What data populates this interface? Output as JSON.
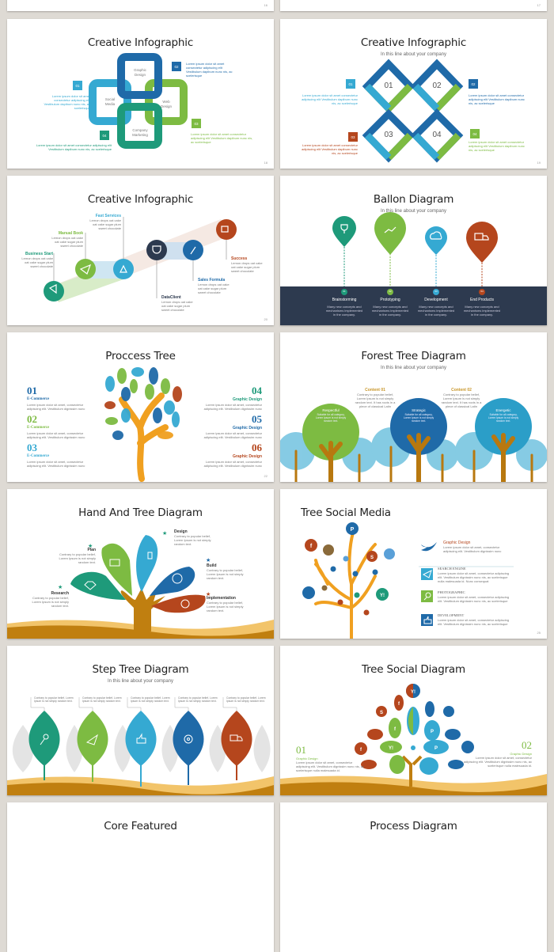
{
  "colors": {
    "background": "#dedad4",
    "teal": "#1e9a7a",
    "green": "#7dbb42",
    "light_blue": "#35a9d2",
    "blue": "#1f6aa8",
    "orange": "#b5461d",
    "navy": "#2d3a4f",
    "brown": "#b8780f"
  },
  "top_row": {
    "left_page": "16",
    "right_page": "17"
  },
  "s1": {
    "title": "Creative Infographic",
    "page": "18",
    "boxes": [
      "Graphic\nDesign",
      "Social\nMedia",
      "Web\nDesign",
      "Company\nMarketing"
    ],
    "badges": [
      "01",
      "02",
      "03",
      "04"
    ],
    "texts": [
      "Lorem ipsum dolor sit amet consectetur adipiscing elit Vestibulum dapibum nunc nis, ac scelerisque",
      "Lorem ipsum dolor sit amet consectetur adipiscing elit Vestibulum dapibum nunc nis, ac scelerisque",
      "Lorem ipsum dolor sit amet consectetur adipiscing elit Vestibulum dapibum nunc nis, ac scelerisque",
      "Lorem ipsum dolor sit amet consectetur adipiscing elit Vestibulum dapibum nunc nis, ac scelerisque"
    ]
  },
  "s2": {
    "title": "Creative Infographic",
    "subtitle": "In this line about your company",
    "page": "19",
    "diamonds": [
      "01",
      "02",
      "03",
      "04"
    ],
    "badges": [
      "01",
      "02",
      "03",
      "04"
    ],
    "texts": [
      "Lorem ipsum dolor sit amet consectetur adipiscing elit Vestibulum dapibum nunc nis, ac scelerisque",
      "Lorem ipsum dolor sit amet consectetur adipiscing elit Vestibulum dapibum nunc nis, ac scelerisque",
      "Lorem ipsum dolor sit amet consectetur adipiscing elit Vestibulum dapibum nunc nis, ac scelerisque",
      "Lorem ipsum dolor sit amet consectetur adipiscing elit Vestibulum dapibum nunc nis, ac scelerisque"
    ]
  },
  "s3": {
    "title": "Creative Infographic",
    "page": "20",
    "steps": [
      {
        "label": "Business Start",
        "text": "Lemon drops oat cake oat cake sugar plum sweet chocolate",
        "icon": "megaphone-icon"
      },
      {
        "label": "Manual Book",
        "text": "Lemon drops oat cake oat cake sugar plum sweet chocolate",
        "icon": "paper-plane-icon"
      },
      {
        "label": "Fast Services",
        "text": "Lemon drops oat cake oat cake sugar plum sweet chocolate",
        "icon": "bell-icon"
      },
      {
        "label": "DataClient",
        "text": "Lemon drops oat cake oat cake sugar plum sweet chocolate",
        "icon": "trophy-icon"
      },
      {
        "label": "Sales Formula",
        "text": "Lemon drops oat cake oat cake sugar plum sweet chocolate",
        "icon": "paperclip-icon"
      },
      {
        "label": "Success",
        "text": "Lemon drops oat cake oat cake sugar plum sweet chocolate",
        "icon": "truck-icon"
      }
    ]
  },
  "s4": {
    "title": "Ballon Diagram",
    "subtitle": "In this line about your company",
    "items": [
      {
        "num": "01",
        "label": "Brainstorming",
        "text": "Many new concepts and mechanisms implemented in the company.",
        "icon": "trophy-icon"
      },
      {
        "num": "02",
        "label": "Prototyping",
        "text": "Many new concepts and mechanisms implemented in the company.",
        "icon": "nodes-icon"
      },
      {
        "num": "03",
        "label": "Development",
        "text": "Many new concepts and mechanisms implemented in the company.",
        "icon": "cloud-icon"
      },
      {
        "num": "04",
        "label": "End Products",
        "text": "Many new concepts and mechanisms implemented in the company.",
        "icon": "truck-icon"
      }
    ]
  },
  "s5": {
    "title": "Proccess Tree",
    "page": "22",
    "items": [
      {
        "num": "01",
        "label": "E-Commerce",
        "text": "Lorem ipsum dolor sit amet, consectetur adipiscing elit. Vestibulum dignissim nunc"
      },
      {
        "num": "02",
        "label": "E-Commerce",
        "text": "Lorem ipsum dolor sit amet, consectetur adipiscing elit. Vestibulum dignissim nunc"
      },
      {
        "num": "03",
        "label": "E-Commerce",
        "text": "Lorem ipsum dolor sit amet, consectetur adipiscing elit. Vestibulum dignissim nunc"
      },
      {
        "num": "04",
        "label": "Graphic Design",
        "text": "Lorem ipsum dolor sit amet, consectetur adipiscing elit. Vestibulum dignissim nunc"
      },
      {
        "num": "05",
        "label": "Graphic Design",
        "text": "Lorem ipsum dolor sit amet, consectetur adipiscing elit. Vestibulum dignissim nunc"
      },
      {
        "num": "06",
        "label": "Graphic Design",
        "text": "Lorem ipsum dolor sit amet, consectetur adipiscing elit. Vestibulum dignissim nunc"
      }
    ]
  },
  "s6": {
    "title": "Forest Tree Diagram",
    "subtitle": "In this line about your company",
    "contents": [
      {
        "label": "Content 01",
        "text": "Contrary to popular belief, Lorem Ipsum is not simply random text. It has roots in a piece of classical Latin"
      },
      {
        "label": "Content 02",
        "text": "Contrary to popular belief, Lorem Ipsum is not simply random text. It has roots in a piece of classical Latin"
      }
    ],
    "trees": [
      {
        "label": "Respectful",
        "text": "Suitable for all category, Lorem Ipsum is not simply random text."
      },
      {
        "label": "Strategic",
        "text": "Suitable for all category, Lorem Ipsum is not simply random text."
      },
      {
        "label": "Energetic",
        "text": "Suitable for all category, Lorem Ipsum is not simply random text."
      }
    ]
  },
  "s7": {
    "title": "Hand And Tree Diagram",
    "items": [
      {
        "label": "Design",
        "text": "Contrary to popular belief, Lorem Ipsum is not simply random text."
      },
      {
        "label": "Plan",
        "text": "Contrary to popular belief, Lorem Ipsum is not simply random text."
      },
      {
        "label": "Build",
        "text": "Contrary to popular belief, Lorem Ipsum is not simply random text."
      },
      {
        "label": "Research",
        "text": "Contrary to popular belief, Lorem Ipsum is not simply random text."
      },
      {
        "label": "Implementation",
        "text": "Contrary to popular belief, Lorem Ipsum is not simply random text."
      }
    ]
  },
  "s8": {
    "title": "Tree Social Media",
    "page": "25",
    "header": {
      "label": "Graphic Design",
      "text": "Lorem ipsum dolor sit amet, consectetur adipiscing elit. Vestibulum dignissim nunc"
    },
    "items": [
      {
        "label": "SEARCH ENGINE",
        "text": "Lorem ipsum dolor sit amet, consectetur adipiscing elit. Vestibulum dignissim nunc nis, ac scelerisque nulla malesuada id. Nunc consequat",
        "icon": "paper-plane-icon"
      },
      {
        "label": "PHOTOGRAPHIC",
        "text": "Lorem ipsum dolor sit amet, consectetur adipiscing elit. Vestibulum dignissim nunc nis, ac scelerisque",
        "icon": "search-icon"
      },
      {
        "label": "DEVELOPMENT",
        "text": "Lorem ipsum dolor sit amet, consectetur adipiscing elit. Vestibulum dignissim nunc nis, ac scelerisque",
        "icon": "thumbs-up-icon"
      }
    ]
  },
  "s9": {
    "title": "Step Tree Diagram",
    "subtitle": "In this line about your company",
    "leaves": [
      {
        "text": "Contrary to popular belief, Lorem Ipsum is not simply random text.",
        "icon": "key-icon"
      },
      {
        "text": "Contrary to popular belief, Lorem Ipsum is not simply random text.",
        "icon": "paper-plane-icon"
      },
      {
        "text": "Contrary to popular belief, Lorem Ipsum is not simply random text.",
        "icon": "thumbs-up-icon"
      },
      {
        "text": "Contrary to popular belief, Lorem Ipsum is not simply random text.",
        "icon": "disc-icon"
      },
      {
        "text": "Contrary to popular belief, Lorem Ipsum is not simply random text.",
        "icon": "truck-icon"
      }
    ]
  },
  "s10": {
    "title": "Tree Social Diagram",
    "items": [
      {
        "num": "01",
        "label": "Graphic Design",
        "text": "Lorem ipsum dolor sit amet, consectetur adipiscing elit. Vestibulum dignissim nunc nis, ac scelerisque nulla malesuada id."
      },
      {
        "num": "02",
        "label": "Graphic Design",
        "text": "Lorem ipsum dolor sit amet, consectetur adipiscing elit. Vestibulum dignissim nunc nis, ac scelerisque nulla malesuada id."
      }
    ]
  },
  "s11": {
    "title": "Core Featured"
  },
  "s12": {
    "title": "Process Diagram"
  }
}
